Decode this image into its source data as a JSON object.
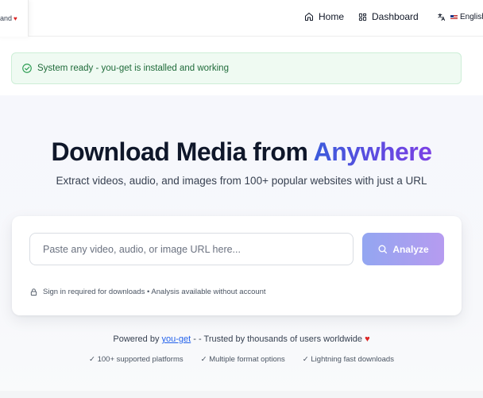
{
  "nav": {
    "left_fragment": "and",
    "home_label": "Home",
    "dashboard_label": "Dashboard",
    "language_label": "English"
  },
  "alert": {
    "message": "System ready - you-get is installed and working"
  },
  "hero": {
    "title_main": "Download Media from ",
    "title_accent": "Anywhere",
    "subtitle": "Extract videos, audio, and images from 100+ popular websites with just a URL"
  },
  "search": {
    "placeholder": "Paste any video, audio, or image URL here...",
    "value": "",
    "button_label": "Analyze",
    "note": "Sign in required for downloads • Analysis available without account"
  },
  "footer": {
    "powered_prefix": "Powered by ",
    "powered_link": "you-get",
    "powered_suffix": " - - Trusted by thousands of users worldwide ",
    "features": [
      "✓ 100+ supported platforms",
      "✓ Multiple format options",
      "✓ Lightning fast downloads"
    ]
  },
  "colors": {
    "accent_start": "#3b5bdb",
    "accent_end": "#7b3fe4",
    "success_bg": "#effaf2",
    "success_text": "#1f6b3a",
    "link": "#2563eb",
    "heart": "#dc2626"
  },
  "icons": {
    "home": "home-icon",
    "dashboard": "dashboard-icon",
    "language": "translate-icon",
    "success": "check-circle-icon",
    "search": "search-icon",
    "lock": "lock-icon",
    "heart": "heart-icon"
  }
}
